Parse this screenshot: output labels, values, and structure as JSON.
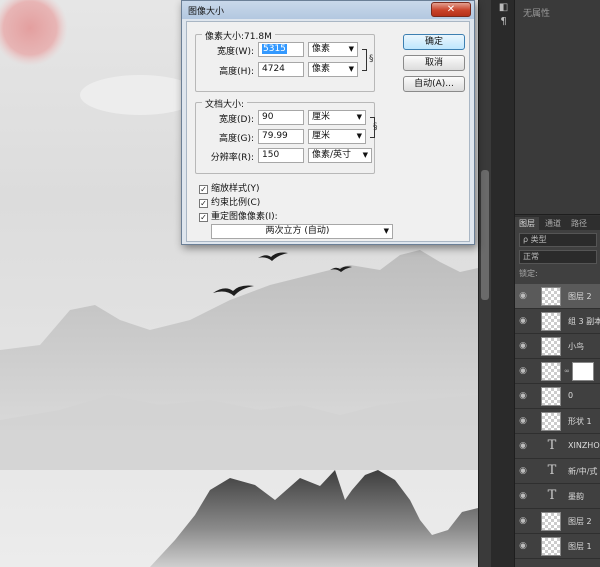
{
  "dialog": {
    "title": "图像大小",
    "close_symbol": "✕",
    "pixel_dimensions": {
      "heading": "像素大小:71.8M",
      "width_label": "宽度(W):",
      "width_value": "5315",
      "width_unit": "像素",
      "height_label": "高度(H):",
      "height_value": "4724",
      "height_unit": "像素"
    },
    "document_size": {
      "heading": "文档大小:",
      "width_label": "宽度(D):",
      "width_value": "90",
      "width_unit": "厘米",
      "height_label": "高度(G):",
      "height_value": "79.99",
      "height_unit": "厘米",
      "resolution_label": "分辨率(R):",
      "resolution_value": "150",
      "resolution_unit": "像素/英寸"
    },
    "buttons": {
      "ok": "确定",
      "cancel": "取消",
      "auto": "自动(A)..."
    },
    "checkboxes": [
      {
        "label": "缩放样式(Y)",
        "checked": true,
        "mark": "✓"
      },
      {
        "label": "约束比例(C)",
        "checked": true,
        "mark": "✓"
      },
      {
        "label": "重定图像像素(I):",
        "checked": true,
        "mark": "✓"
      }
    ],
    "resample_method": "两次立方 (自动)"
  },
  "properties_panel": {
    "label": "无属性"
  },
  "layers_panel": {
    "tabs": [
      "图层",
      "通道",
      "路径"
    ],
    "filter_label": "ρ 类型",
    "blend_mode": "正常",
    "lock_label": "锁定:",
    "layers": [
      {
        "name": "图层 2",
        "kind": "pixel",
        "active": true
      },
      {
        "name": "组 3 副本",
        "kind": "pixel",
        "active": false
      },
      {
        "name": "小鸟",
        "kind": "pixel",
        "active": false
      },
      {
        "name": "",
        "kind": "masked",
        "active": false
      },
      {
        "name": "0",
        "kind": "pixel",
        "active": false
      },
      {
        "name": "形状 1",
        "kind": "pixel",
        "active": false
      },
      {
        "name": "XINZHONG",
        "kind": "text",
        "active": false
      },
      {
        "name": "新/中/式",
        "kind": "text",
        "active": false
      },
      {
        "name": "墨韵",
        "kind": "text",
        "active": false
      },
      {
        "name": "图层 2",
        "kind": "pixel",
        "active": false
      },
      {
        "name": "图层 1",
        "kind": "pixel",
        "active": false
      }
    ]
  },
  "icons": {
    "eye": "eye-icon",
    "text_layer": "T",
    "chain": "chain-icon"
  },
  "colors": {
    "sun": "#e6a0a0",
    "ink": "#3a3a3a",
    "dialog_bg": "#f0f0f0",
    "panel_bg": "#404040"
  }
}
